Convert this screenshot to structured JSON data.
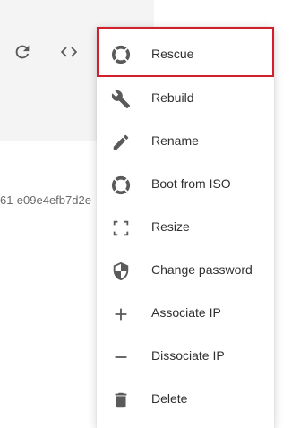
{
  "background": {
    "id_text": "61-e09e4efb7d2e"
  },
  "toolbar": {
    "refresh_icon": "refresh-icon",
    "code_icon": "code-icon"
  },
  "menu": {
    "items": [
      {
        "label": "Rescue",
        "icon": "lifebuoy-icon",
        "active": true
      },
      {
        "label": "Rebuild",
        "icon": "wrench-icon"
      },
      {
        "label": "Rename",
        "icon": "pencil-icon"
      },
      {
        "label": "Boot from ISO",
        "icon": "lifebuoy-icon"
      },
      {
        "label": "Resize",
        "icon": "resize-icon"
      },
      {
        "label": "Change password",
        "icon": "shield-icon"
      },
      {
        "label": "Associate IP",
        "icon": "plus-icon"
      },
      {
        "label": "Dissociate IP",
        "icon": "minus-icon"
      },
      {
        "label": "Delete",
        "icon": "trash-icon"
      }
    ]
  },
  "colors": {
    "highlight_border": "#d21f2b",
    "icon": "#5a5a5a",
    "text": "#2f2f2f"
  }
}
